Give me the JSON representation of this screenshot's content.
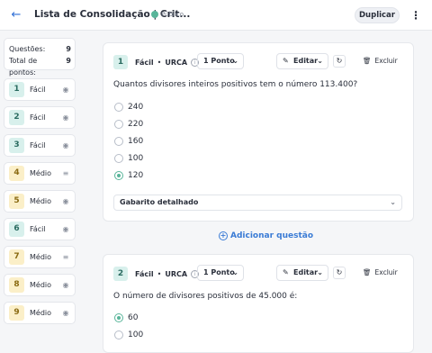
{
  "header": {
    "back_icon": "arrow-left-icon",
    "title": "Lista de Consolidação | Crit...",
    "visibility": "Público",
    "duplicate_label": "Duplicar",
    "menu_icon": "kebab-icon"
  },
  "summary": {
    "questions_label": "Questões:",
    "questions_count": "9",
    "points_label": "Total de pontos:",
    "points_count": "9"
  },
  "questions_list": [
    {
      "num": "1",
      "level": "Fácil"
    },
    {
      "num": "2",
      "level": "Fácil"
    },
    {
      "num": "3",
      "level": "Fácil"
    },
    {
      "num": "4",
      "level": "Médio"
    },
    {
      "num": "5",
      "level": "Médio"
    },
    {
      "num": "6",
      "level": "Fácil"
    },
    {
      "num": "7",
      "level": "Médio"
    },
    {
      "num": "8",
      "level": "Médio"
    },
    {
      "num": "9",
      "level": "Médio"
    }
  ],
  "q1": {
    "num": "1",
    "level": "Fácil",
    "sep": "•",
    "tag": "URCA",
    "points": "1 Ponto",
    "edit": "Editar",
    "delete": "Excluir",
    "text": "Quantos divisores inteiros positivos tem o número 113.400?",
    "options": [
      "240",
      "220",
      "160",
      "100",
      "120"
    ],
    "selected_index": 4,
    "answer_label": "Gabarito detalhado"
  },
  "add_question": "Adicionar questão",
  "q2": {
    "num": "2",
    "level": "Fácil",
    "sep": "•",
    "tag": "URCA",
    "points": "1 Ponto",
    "edit": "Editar",
    "delete": "Excluir",
    "text": "O número de divisores positivos de 45.000 é:",
    "options": [
      "60",
      "100"
    ],
    "selected_index": 0
  },
  "colors": {
    "accent": "#3a7bd5",
    "easy_bg": "#d8f0ec",
    "medium_bg": "#fbefc8",
    "selected": "#59b59a"
  }
}
